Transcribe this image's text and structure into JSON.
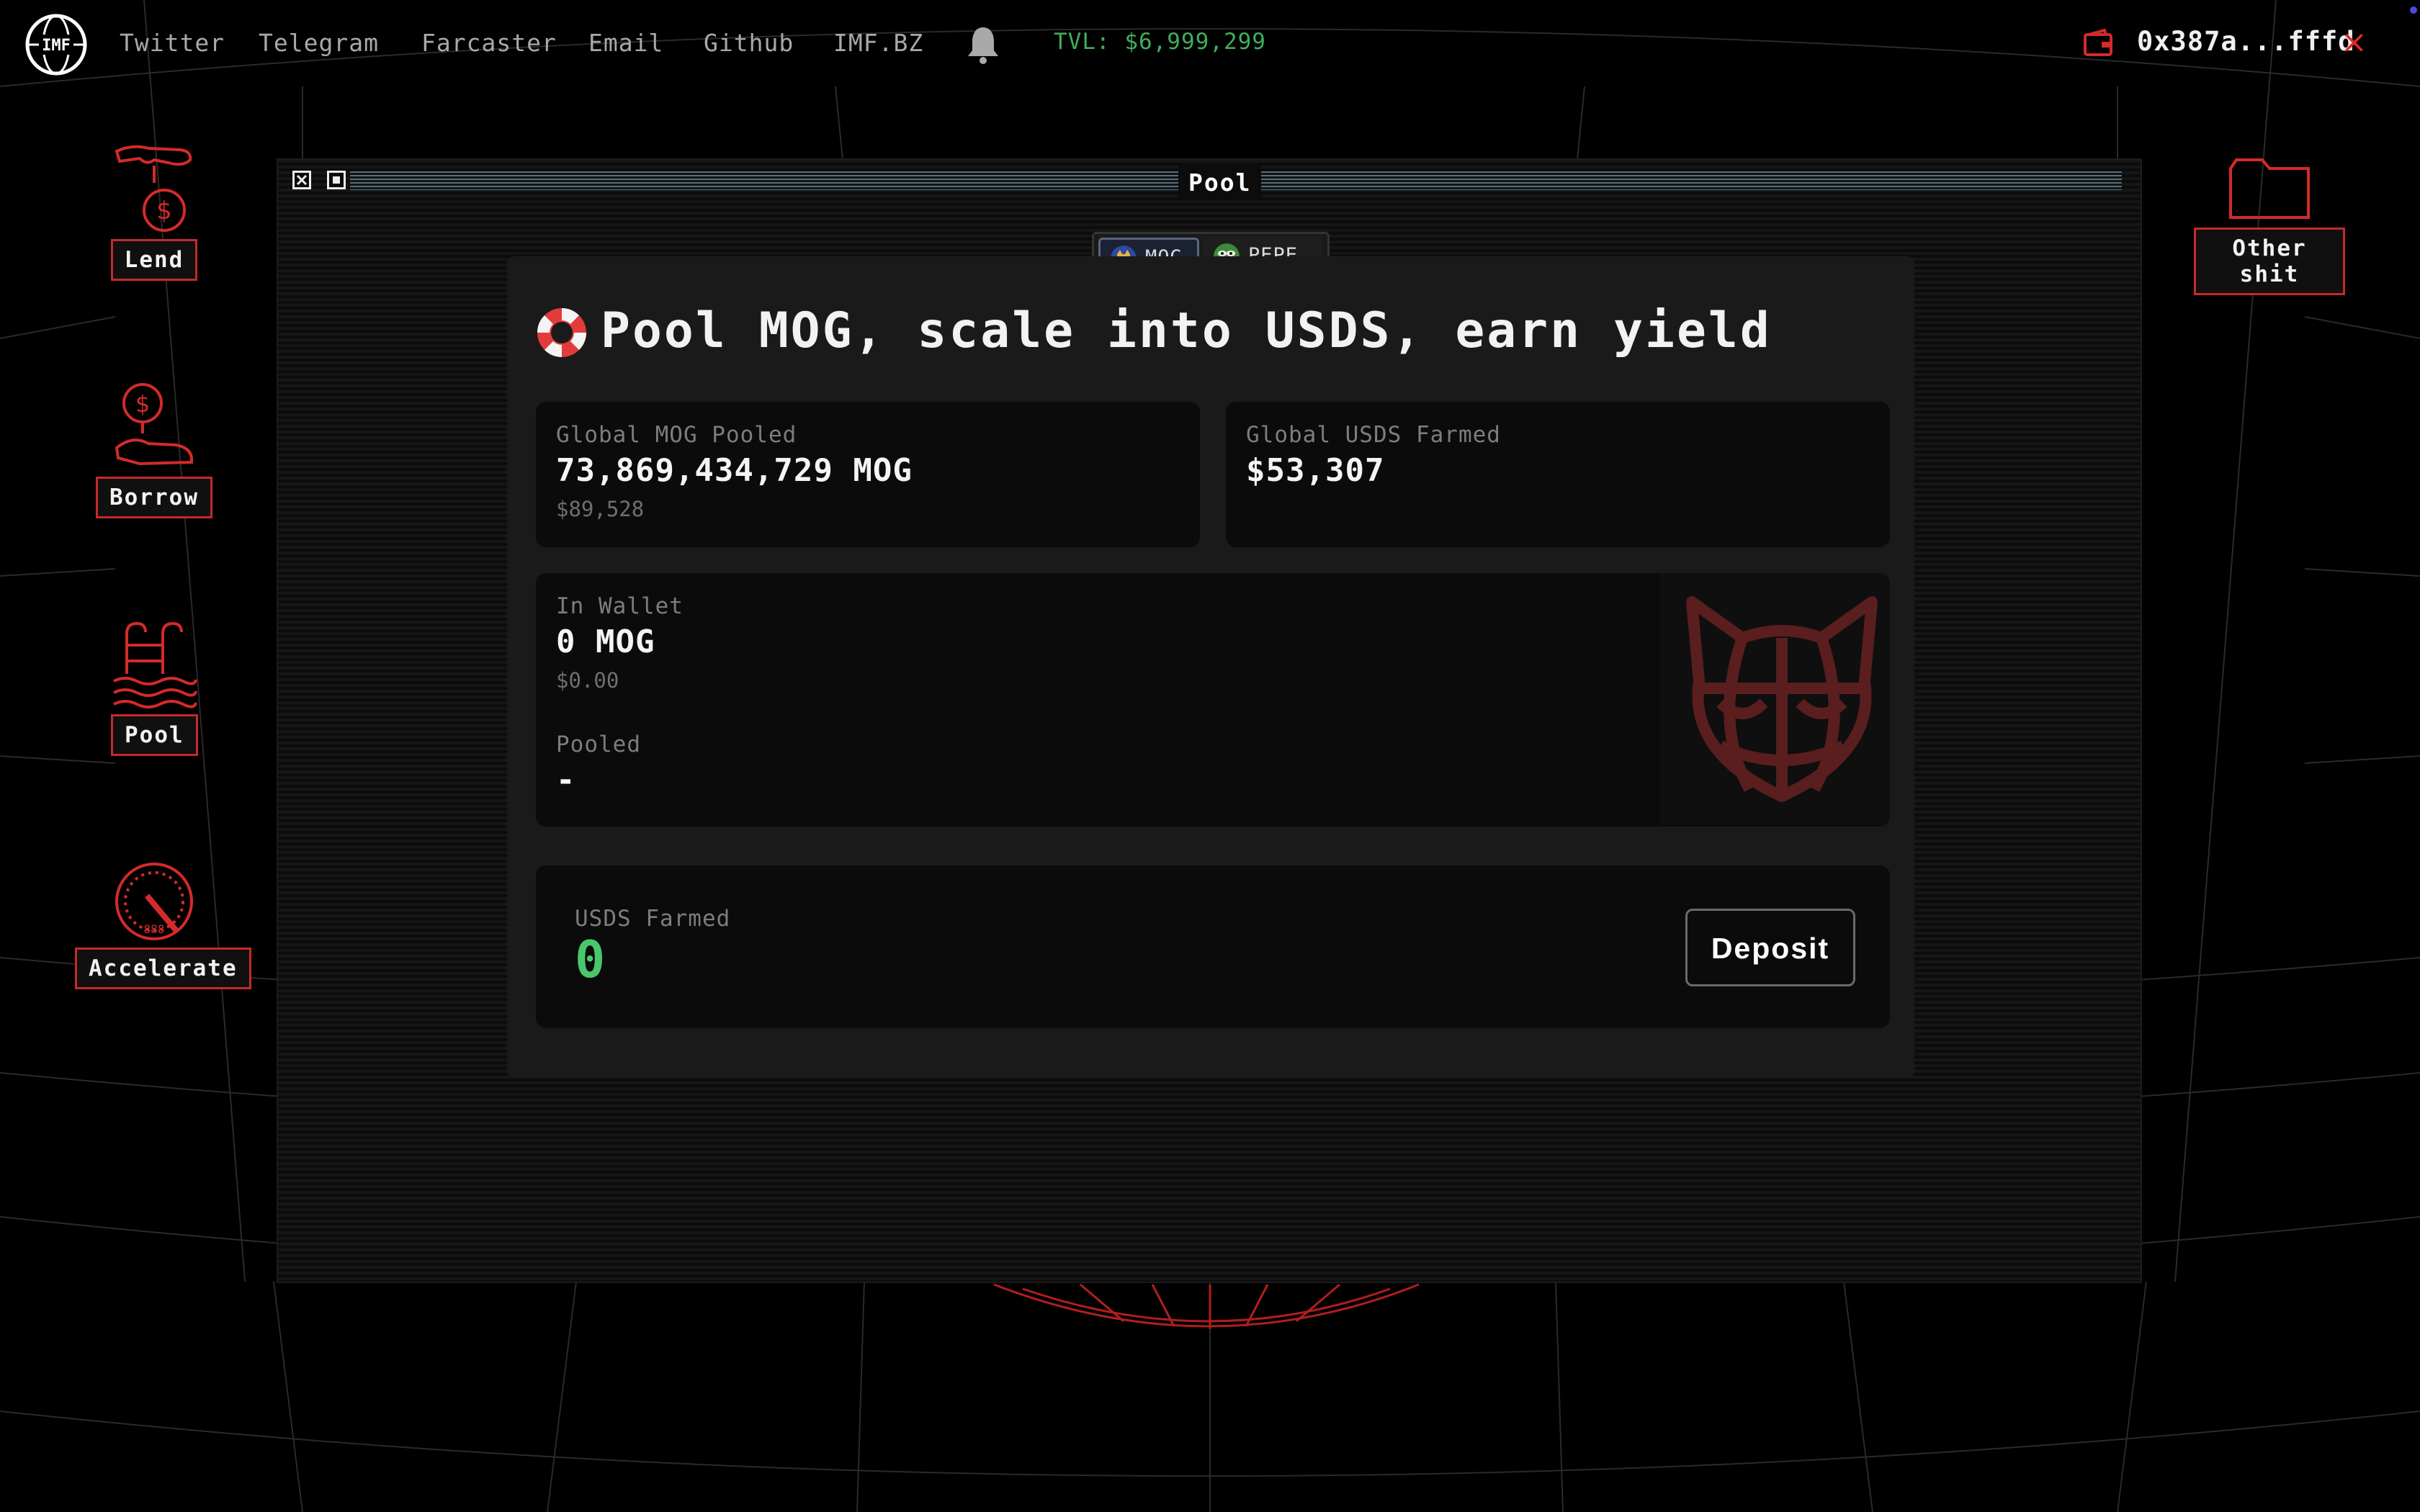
{
  "nav": {
    "links": [
      "Twitter",
      "Telegram",
      "Farcaster",
      "Email",
      "Github",
      "IMF.BZ"
    ],
    "tvl": "TVL: $6,999,299",
    "wallet_address": "0x387a...fffd",
    "close_symbol": "×"
  },
  "desktop": {
    "left_icons": [
      "Lend",
      "Borrow",
      "Pool",
      "Accelerate"
    ],
    "right_icon": "Other shit"
  },
  "window": {
    "title": "Pool",
    "tabs": [
      {
        "label": "MOG",
        "selected": true
      },
      {
        "label": "PEPE",
        "selected": false
      }
    ],
    "headline": "Pool MOG, scale into USDS, earn yield",
    "global_pooled": {
      "label": "Global MOG Pooled",
      "value": "73,869,434,729 MOG",
      "usd": "$89,528"
    },
    "global_farmed": {
      "label": "Global USDS Farmed",
      "value": "$53,307"
    },
    "wallet": {
      "label": "In Wallet",
      "value": "0 MOG",
      "usd": "$0.00"
    },
    "pooled": {
      "label": "Pooled",
      "value": "-"
    },
    "farmed": {
      "label": "USDS Farmed",
      "value": "0"
    },
    "deposit_label": "Deposit"
  },
  "colors": {
    "accent_red": "#d42a2a",
    "tvl_green": "#3fae5c",
    "farmed_green": "#48c76b",
    "background": "#000000"
  }
}
